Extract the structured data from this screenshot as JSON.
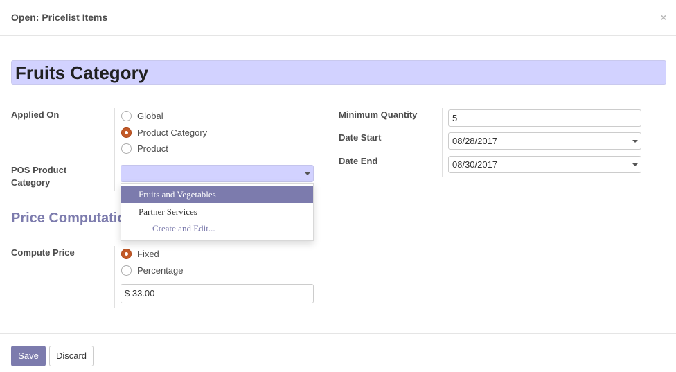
{
  "dialog": {
    "title": "Open: Pricelist Items",
    "close_icon": "×"
  },
  "record": {
    "name": "Fruits Category"
  },
  "applied_on": {
    "label": "Applied On",
    "options": [
      {
        "label": "Global",
        "checked": false
      },
      {
        "label": "Product Category",
        "checked": true
      },
      {
        "label": "Product",
        "checked": false
      }
    ]
  },
  "pos_category": {
    "label_line1": "POS Product",
    "label_line2": "Category",
    "value": "",
    "dropdown": {
      "items": [
        {
          "label": "Fruits and Vegetables",
          "active": true
        },
        {
          "label": "Partner Services",
          "active": false
        }
      ],
      "create_label": "Create and Edit..."
    }
  },
  "right_fields": {
    "min_qty": {
      "label": "Minimum Quantity",
      "value": "5"
    },
    "date_start": {
      "label": "Date Start",
      "value": "08/28/2017"
    },
    "date_end": {
      "label": "Date End",
      "value": "08/30/2017"
    }
  },
  "price_computation": {
    "section_title": "Price Computation",
    "compute_label": "Compute Price",
    "options": [
      {
        "label": "Fixed",
        "checked": true
      },
      {
        "label": "Percentage",
        "checked": false
      }
    ],
    "fixed_price": "$ 33.00"
  },
  "footer": {
    "save_label": "Save",
    "discard_label": "Discard"
  },
  "colors": {
    "accent": "#7c7bad",
    "required_field_bg": "#d2d2ff",
    "radio_checked": "#c35a28"
  }
}
